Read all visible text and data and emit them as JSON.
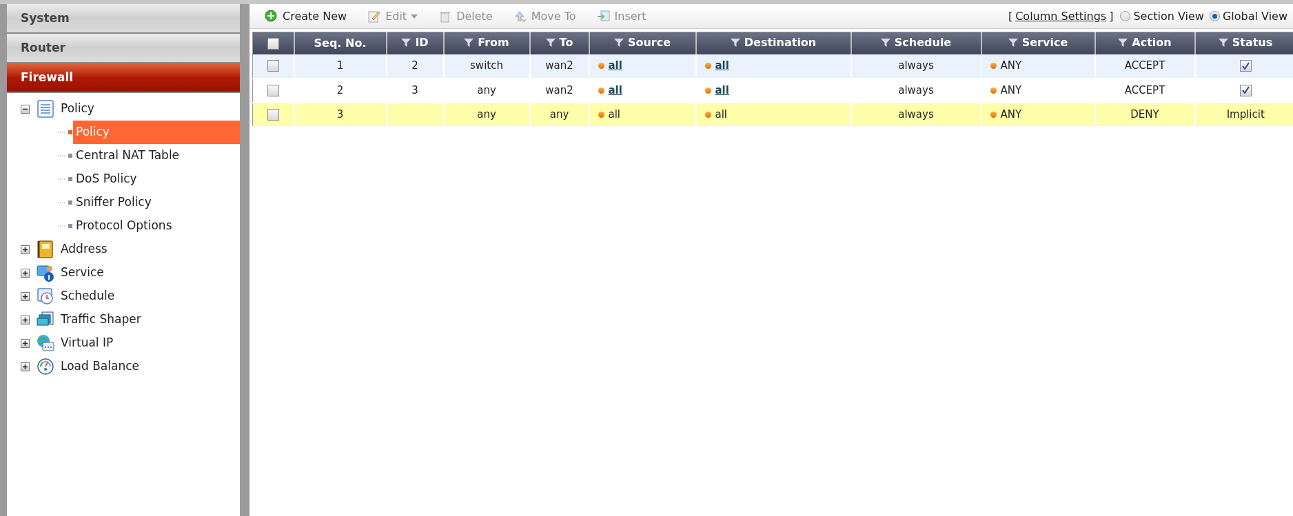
{
  "sidebar": {
    "sections": [
      {
        "label": "System",
        "selected": false
      },
      {
        "label": "Router",
        "selected": false
      },
      {
        "label": "Firewall",
        "selected": true
      }
    ],
    "tree": [
      {
        "label": "Policy",
        "expanded": true,
        "children": [
          {
            "label": "Policy",
            "selected": true
          },
          {
            "label": "Central NAT Table",
            "selected": false
          },
          {
            "label": "DoS Policy",
            "selected": false
          },
          {
            "label": "Sniffer Policy",
            "selected": false
          },
          {
            "label": "Protocol Options",
            "selected": false
          }
        ]
      },
      {
        "label": "Address",
        "expanded": false
      },
      {
        "label": "Service",
        "expanded": false
      },
      {
        "label": "Schedule",
        "expanded": false
      },
      {
        "label": "Traffic Shaper",
        "expanded": false
      },
      {
        "label": "Virtual IP",
        "expanded": false
      },
      {
        "label": "Load Balance",
        "expanded": false
      }
    ]
  },
  "toolbar": {
    "buttons": [
      {
        "label": "Create New",
        "disabled": false,
        "dropdown": false
      },
      {
        "label": "Edit",
        "disabled": true,
        "dropdown": true
      },
      {
        "label": "Delete",
        "disabled": true,
        "dropdown": false
      },
      {
        "label": "Move To",
        "disabled": true,
        "dropdown": false
      },
      {
        "label": "Insert",
        "disabled": true,
        "dropdown": false
      }
    ],
    "open_bracket": "[",
    "column_settings": "Column Settings",
    "close_bracket": "]",
    "views": [
      {
        "label": "Section View",
        "selected": false
      },
      {
        "label": "Global View",
        "selected": true
      }
    ]
  },
  "table": {
    "select_all_checked": false,
    "columns": [
      {
        "label": "Seq. No.",
        "filter": false
      },
      {
        "label": "ID",
        "filter": true
      },
      {
        "label": "From",
        "filter": true
      },
      {
        "label": "To",
        "filter": true
      },
      {
        "label": "Source",
        "filter": true
      },
      {
        "label": "Destination",
        "filter": true
      },
      {
        "label": "Schedule",
        "filter": true
      },
      {
        "label": "Service",
        "filter": true
      },
      {
        "label": "Action",
        "filter": true
      },
      {
        "label": "Status",
        "filter": true
      }
    ],
    "rows": [
      {
        "kind": "policy",
        "checked": false,
        "seq": "1",
        "id": "2",
        "from": "switch",
        "to": "wan2",
        "source": "all",
        "destination": "all",
        "schedule": "always",
        "service": "ANY",
        "action": "ACCEPT",
        "status": {
          "kind": "checkbox",
          "checked": true
        }
      },
      {
        "kind": "policy",
        "checked": false,
        "seq": "2",
        "id": "3",
        "from": "any",
        "to": "wan2",
        "source": "all",
        "destination": "all",
        "schedule": "always",
        "service": "ANY",
        "action": "ACCEPT",
        "status": {
          "kind": "checkbox",
          "checked": true
        }
      },
      {
        "kind": "implicit",
        "checked": false,
        "seq": "3",
        "from": "any",
        "to": "any",
        "source": "all",
        "destination": "all",
        "schedule": "always",
        "service": "ANY",
        "action": "DENY",
        "status": {
          "kind": "text",
          "text": "Implicit"
        }
      }
    ]
  }
}
